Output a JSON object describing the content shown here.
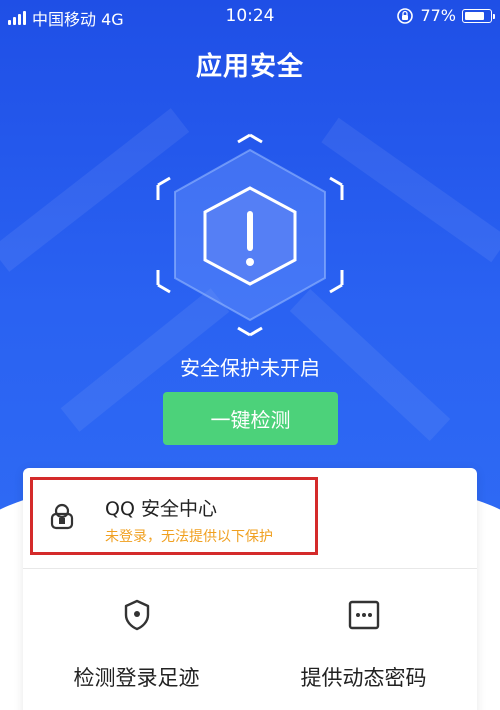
{
  "status_bar": {
    "carrier": "中国移动 4G",
    "time": "10:24",
    "battery": "77%",
    "battery_level": 0.77
  },
  "header": {
    "title": "应用安全"
  },
  "hero": {
    "status": "安全保护未开启",
    "scan_button": "一键检测"
  },
  "qq_center": {
    "title": "QQ 安全中心",
    "subtitle": "未登录，无法提供以下保护"
  },
  "features": [
    {
      "label": "检测登录足迹",
      "icon": "location-shield-icon"
    },
    {
      "label": "提供动态密码",
      "icon": "dynamic-password-icon"
    }
  ],
  "colors": {
    "hero_blue": "#2a62f2",
    "button_green": "#4cd27a",
    "warning_orange": "#f0a020",
    "highlight_red": "#d42a2a"
  }
}
